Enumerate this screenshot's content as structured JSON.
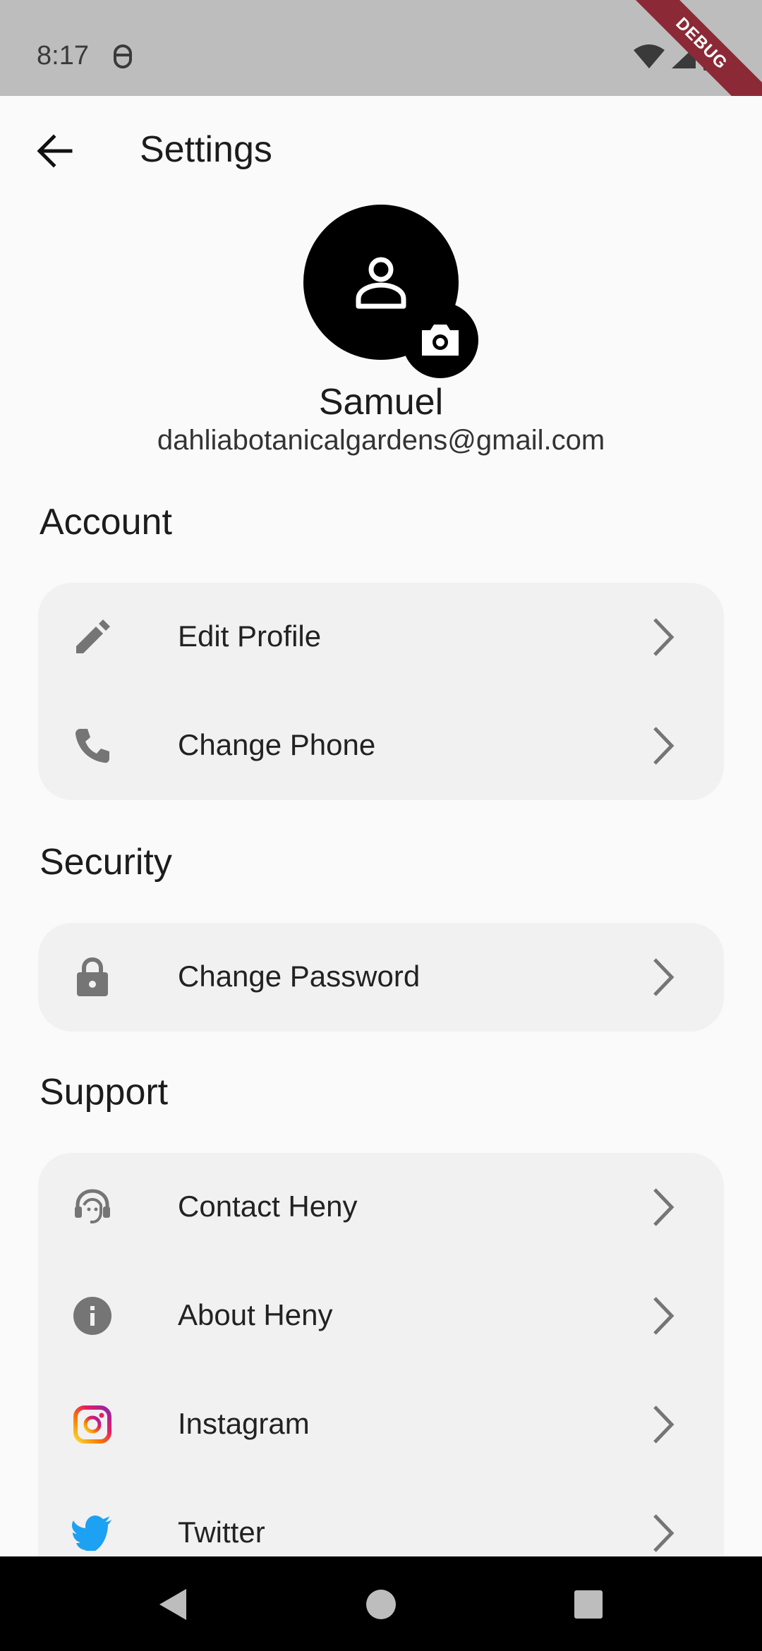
{
  "status_bar": {
    "time": "8:17",
    "debug_label": "DEBUG"
  },
  "app_bar": {
    "title": "Settings",
    "back_icon": "arrow-back-icon"
  },
  "profile": {
    "name": "Samuel",
    "email": "dahliabotanicalgardens@gmail.com",
    "avatar_icon": "person-icon",
    "camera_icon": "camera-icon"
  },
  "sections": {
    "account": {
      "heading": "Account",
      "items": [
        {
          "label": "Edit Profile",
          "icon": "pencil-icon"
        },
        {
          "label": "Change Phone",
          "icon": "phone-icon"
        }
      ]
    },
    "security": {
      "heading": "Security",
      "items": [
        {
          "label": "Change Password",
          "icon": "lock-icon"
        }
      ]
    },
    "support": {
      "heading": "Support",
      "items": [
        {
          "label": "Contact Heny",
          "icon": "headset-icon"
        },
        {
          "label": "About Heny",
          "icon": "info-icon"
        },
        {
          "label": "Instagram",
          "icon": "instagram-icon"
        },
        {
          "label": "Twitter",
          "icon": "twitter-icon"
        }
      ]
    }
  },
  "colors": {
    "icon_gray": "#757575",
    "card_bg": "#f1f1f1",
    "page_bg": "#fafafa",
    "twitter_blue": "#1da1f2",
    "debug_red": "#8b2a36"
  }
}
